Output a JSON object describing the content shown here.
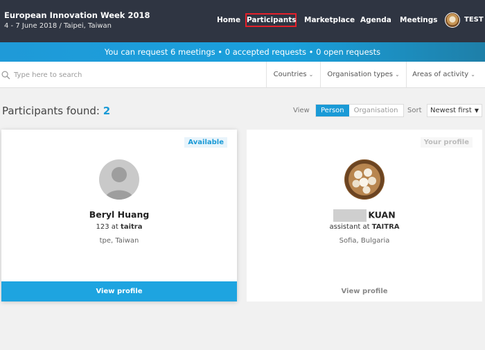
{
  "header": {
    "event_title": "European Innovation Week 2018",
    "event_subtitle": "4 - 7 June 2018 / Taipei, Taiwan",
    "nav": {
      "home": "Home",
      "participants": "Participants",
      "marketplace": "Marketplace",
      "agenda": "Agenda",
      "meetings": "Meetings"
    },
    "user_label": "TEST"
  },
  "banner": {
    "text": "You can request 6 meetings • 0 accepted requests • 0 open requests"
  },
  "filters": {
    "search_placeholder": "Type here to search",
    "countries": "Countries",
    "organisation_types": "Organisation types",
    "areas_of_activity": "Areas of activity"
  },
  "results": {
    "found_label": "Participants found:",
    "found_count": "2",
    "view_label": "View",
    "view_person": "Person",
    "view_organisation": "Organisation",
    "sort_label": "Sort",
    "sort_value": "Newest first"
  },
  "participants": [
    {
      "badge": "Available",
      "name": "Beryl Huang",
      "role": "123 at",
      "organisation": "taitra",
      "location": "tpe, Taiwan",
      "cta": "View profile"
    },
    {
      "badge": "Your profile",
      "name": "KUAN",
      "role": "assistant at",
      "organisation": "TAITRA",
      "location": "Sofia, Bulgaria",
      "cta": "View profile"
    }
  ],
  "colors": {
    "header_bg": "#2f3542",
    "accent": "#1a9ad6",
    "nav_highlight": "#e5202a"
  }
}
